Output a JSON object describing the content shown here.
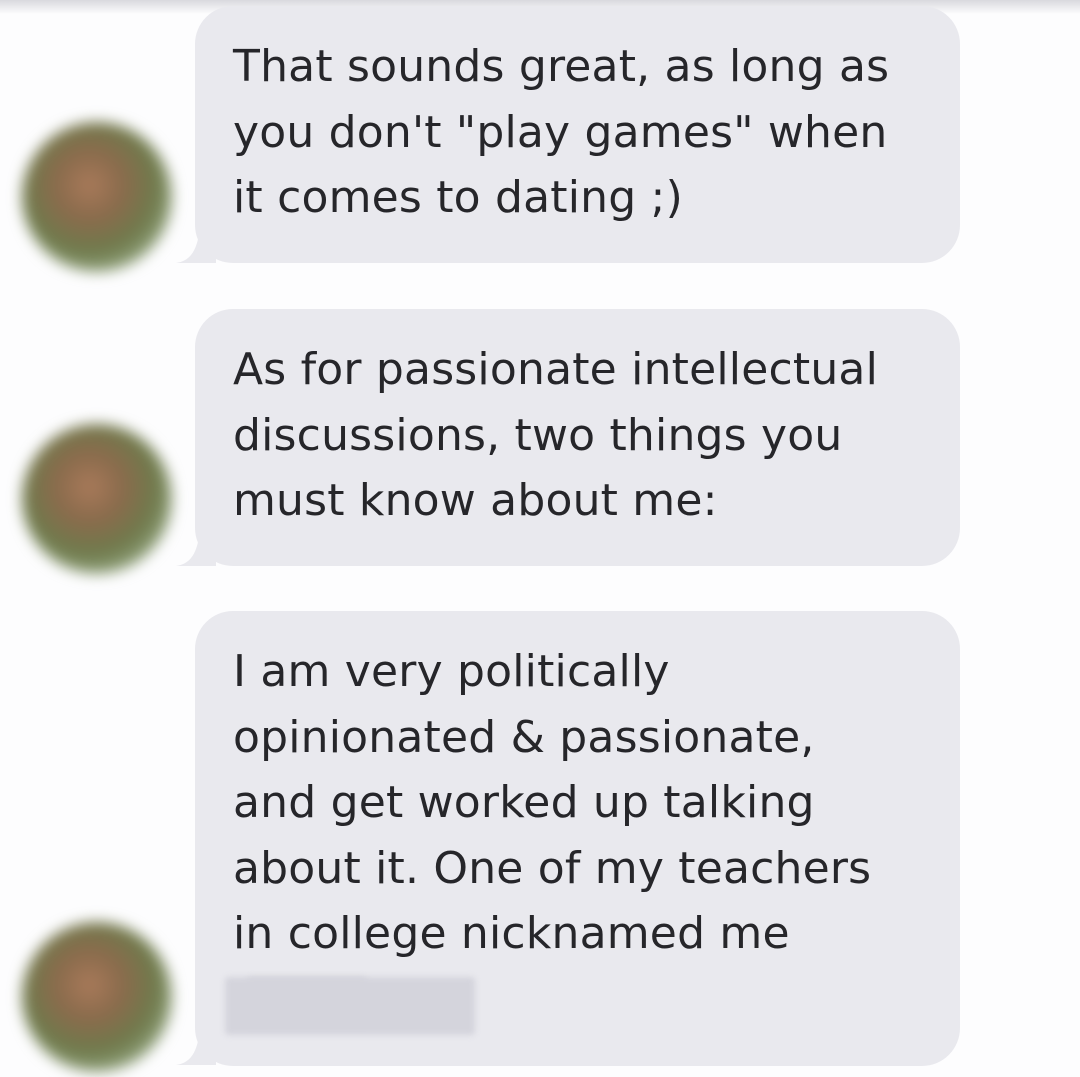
{
  "conversation": {
    "messages": [
      {
        "lines": [
          "That sounds great, as long as",
          "you don't \"play games\" when",
          "it comes to dating ;)"
        ]
      },
      {
        "lines": [
          "As for passionate intellectual",
          "discussions, two things you",
          "must know about me:"
        ]
      },
      {
        "lines": [
          "I am very politically",
          "opinionated & passionate,",
          "and get worked up talking",
          "about it. One of my teachers",
          "in college nicknamed me"
        ],
        "redacted_name": true
      }
    ]
  },
  "colors": {
    "bubble_background": "#e9e9ee",
    "text": "#26262a",
    "page_background": "#fdfdfe"
  },
  "icons": {
    "avatar": "blurred-profile-photo",
    "redaction": "blurred-name"
  }
}
